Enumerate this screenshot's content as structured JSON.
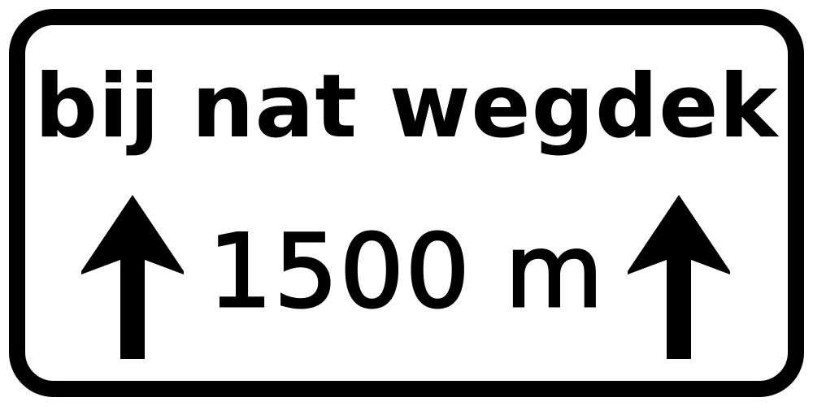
{
  "sign": {
    "line1": "bij nat wegdek",
    "line2": "1500 m",
    "left_arrow_icon": "arrow-up-icon",
    "right_arrow_icon": "arrow-up-icon",
    "border_color": "#000000",
    "background_color": "#ffffff",
    "text_color": "#000000"
  }
}
